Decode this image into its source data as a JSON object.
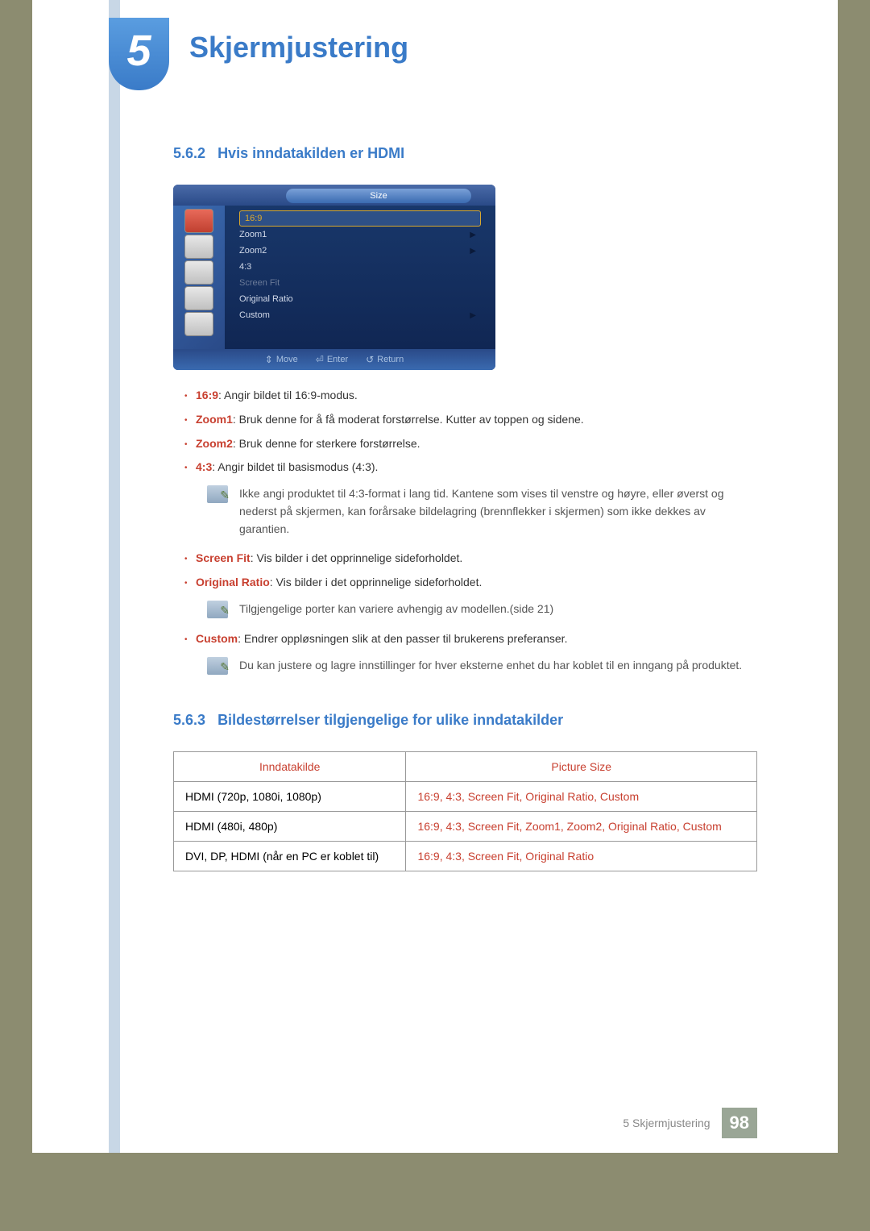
{
  "chapter": {
    "number": "5",
    "title": "Skjermjustering"
  },
  "section_562": {
    "number": "5.6.2",
    "title": "Hvis inndatakilden er HDMI"
  },
  "osd": {
    "title": "Size",
    "options": {
      "o0": "16:9",
      "o1": "Zoom1",
      "o2": "Zoom2",
      "o3": "4:3",
      "o4": "Screen Fit",
      "o5": "Original Ratio",
      "o6": "Custom"
    },
    "footer": {
      "move": "Move",
      "enter": "Enter",
      "return": "Return"
    }
  },
  "bullets": {
    "b0k": "16:9",
    "b0t": ": Angir bildet til 16:9-modus.",
    "b1k": "Zoom1",
    "b1t": ": Bruk denne for å få moderat forstørrelse. Kutter av toppen og sidene.",
    "b2k": "Zoom2",
    "b2t": ": Bruk denne for sterkere forstørrelse.",
    "b3k": "4:3",
    "b3t": ": Angir bildet til basismodus (4:3).",
    "note1": "Ikke angi produktet til 4:3-format i lang tid. Kantene som vises til venstre og høyre, eller øverst og nederst på skjermen, kan forårsake bildelagring (brennflekker i skjermen) som ikke dekkes av garantien.",
    "b4k": "Screen Fit",
    "b4t": ": Vis bilder i det opprinnelige sideforholdet.",
    "b5k": "Original Ratio",
    "b5t": ": Vis bilder i det opprinnelige sideforholdet.",
    "note2": "Tilgjengelige porter kan variere avhengig av modellen.(side 21)",
    "b6k": "Custom",
    "b6t": ": Endrer oppløsningen slik at den passer til brukerens preferanser.",
    "note3": "Du kan justere og lagre innstillinger for hver eksterne enhet du har koblet til en inngang på produktet."
  },
  "section_563": {
    "number": "5.6.3",
    "title": "Bildestørrelser tilgjengelige for ulike inndatakilder"
  },
  "table": {
    "h1": "Inndatakilde",
    "h2": "Picture Size",
    "r1c1": "HDMI (720p, 1080i, 1080p)",
    "r1c2": "16:9, 4:3, Screen Fit, Original Ratio, Custom",
    "r2c1": "HDMI (480i, 480p)",
    "r2c2": "16:9, 4:3, Screen Fit, Zoom1, Zoom2, Original Ratio, Custom",
    "r3c1": "DVI, DP, HDMI (når en PC er koblet til)",
    "r3c2": "16:9, 4:3, Screen Fit, Original Ratio"
  },
  "footer": {
    "label": "5 Skjermjustering",
    "page": "98"
  }
}
